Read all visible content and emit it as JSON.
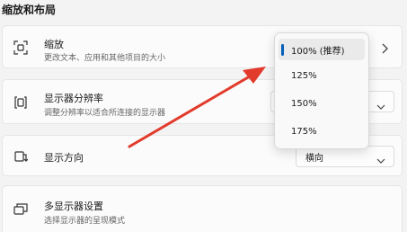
{
  "section_title": "缩放和布局",
  "scale": {
    "title": "缩放",
    "description": "更改文本、应用和其他项目的大小",
    "options": [
      {
        "label": "100% (推荐)",
        "selected": true
      },
      {
        "label": "125%",
        "selected": false
      },
      {
        "label": "150%",
        "selected": false
      },
      {
        "label": "175%",
        "selected": false
      }
    ]
  },
  "resolution": {
    "title": "显示器分辨率",
    "description": "调整分辨率以适合所连接的显示器"
  },
  "orientation": {
    "title": "显示方向",
    "value": "横向"
  },
  "multi_display": {
    "title": "多显示器设置",
    "description": "选择显示器的呈现模式"
  },
  "colors": {
    "accent": "#005fb8",
    "annotation_arrow": "#e23a2b"
  },
  "icons": {
    "scale": "scale-icon",
    "resolution": "resolution-icon",
    "orientation": "orientation-icon",
    "multi_display": "multi-display-icon"
  }
}
